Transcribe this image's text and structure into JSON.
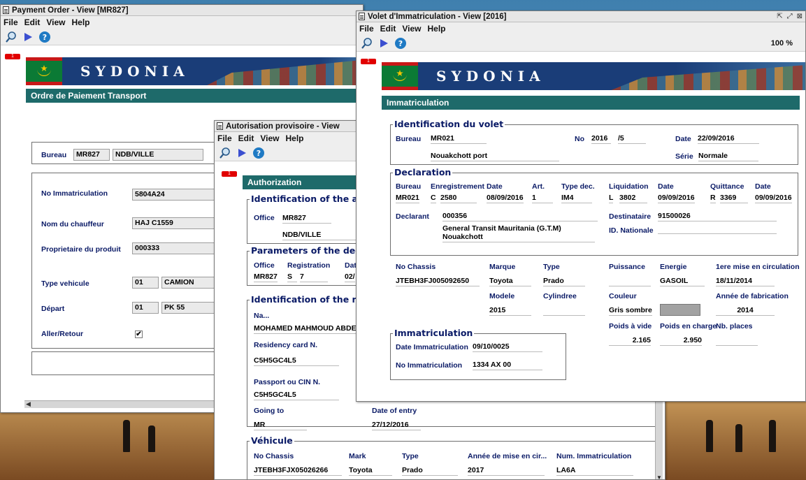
{
  "payment_window": {
    "title": "Payment Order - View [MR827]",
    "menu": [
      "File",
      "Edit",
      "View",
      "Help"
    ],
    "page_tag": "1",
    "banner_brand": "SYDONIA",
    "section_title": "Ordre de Paiement Transport",
    "bureau_label": "Bureau",
    "bureau_code": "MR827",
    "bureau_name": "NDB/VILLE",
    "fields": {
      "immatriculation_label": "No Immatriculation",
      "immatriculation_value": "5804A24",
      "chauffeur_label": "Nom du chauffeur",
      "chauffeur_value": "HAJ  C1559",
      "proprietaire_label": "Proprietaire du produit",
      "proprietaire_value": "000333",
      "type_vehicule_label": "Type vehicule",
      "type_vehicule_code": "01",
      "type_vehicule_value": "CAMION",
      "depart_label": "Départ",
      "depart_code": "01",
      "depart_value": "PK 55",
      "aller_retour_label": "Aller/Retour",
      "aller_retour_check": "✔"
    },
    "scroll_left": "◀"
  },
  "auth_window": {
    "title": "Autorisation provisoire - View",
    "menu": [
      "File",
      "Edit",
      "View",
      "Help"
    ],
    "page_tag": "1",
    "section_title": "Authorization",
    "identification_title": "Identification of the aut",
    "office_label": "Office",
    "office_code": "MR827",
    "office_name": "NDB/VILLE",
    "parameters_title": "Parameters of the decl",
    "param_office_label": "Office",
    "param_registration_label": "Registration",
    "param_date_label": "Dat",
    "param_office_value": "MR827",
    "param_registration_series": "S",
    "param_registration_number": "7",
    "param_date_value": "02/",
    "recipient_title": "Identification of the rec",
    "name_label": "Na...",
    "name_value": "MOHAMED MAHMOUD ABDELL",
    "residency_label": "Residency card N.",
    "residency_value": "C5H5GC4L5",
    "passport_label": "Passport ou CIN N.",
    "passport_value": "C5H5GC4L5",
    "going_to_label": "Going to",
    "going_to_value": "MR",
    "date_entry_label": "Date of entry",
    "date_entry_value": "27/12/2016",
    "vehicule_title": "Véhicule",
    "vehicule_headers": [
      "No Chassis",
      "Mark",
      "Type",
      "Année de mise en cir...",
      "Num. Immatriculation"
    ],
    "vehicule_values": [
      "JTEBH3FJX05026266",
      "Toyota",
      "Prado",
      "2017",
      "LA6A"
    ],
    "scroll_down": "▼"
  },
  "volet_window": {
    "title": "Volet d'Immatriculation - View [2016]",
    "title_controls": [
      "⇱",
      "⤢",
      "⊠"
    ],
    "menu": [
      "File",
      "Edit",
      "View",
      "Help"
    ],
    "zoom": "100 %",
    "page_tag": "1",
    "banner_brand": "SYDONIA",
    "section_title": "Immatriculation",
    "identification": {
      "title": "Identification du volet",
      "bureau_label": "Bureau",
      "bureau_value": "MR021",
      "no_label": "No",
      "no_year": "2016",
      "no_number": "/5",
      "date_label": "Date",
      "date_value": "22/09/2016",
      "bureau_name": "Nouakchott port",
      "serie_label": "Série",
      "serie_value": "Normale"
    },
    "declaration": {
      "title": "Declaration",
      "headers": [
        "Bureau",
        "Enregistrement",
        "Date",
        "Art.",
        "Type dec.",
        "Liquidation",
        "Date",
        "Quittance",
        "Date"
      ],
      "bureau": "MR021",
      "enr_series": "C",
      "enr_number": "2580",
      "enr_date": "08/09/2016",
      "article": "1",
      "type_dec": "IM4",
      "liq_series": "L",
      "liq_number": "3802",
      "liq_date": "09/09/2016",
      "quit_series": "R",
      "quit_number": "3369",
      "quit_date": "09/09/2016",
      "declarant_label": "Declarant",
      "declarant_code": "000356",
      "declarant_name": "General Transit Mauritania (G.T.M)",
      "declarant_city": "Nouakchott",
      "destinataire_label": "Destinataire",
      "destinataire_value": "91500026",
      "id_nationale_label": "ID. Nationale"
    },
    "vehicle": {
      "chassis_label": "No Chassis",
      "chassis_value": "JTEBH3FJ005092650",
      "marque_label": "Marque",
      "marque_value": "Toyota",
      "type_label": "Type",
      "type_value": "Prado",
      "puissance_label": "Puissance",
      "energie_label": "Energie",
      "energie_value": "GASOIL",
      "premiere_label": "1ere mise en circulation",
      "premiere_value": "18/11/2014",
      "modele_label": "Modele",
      "modele_value": "2015",
      "cylindree_label": "Cylindree",
      "couleur_label": "Couleur",
      "couleur_value": "Gris sombre",
      "annee_label": "Année de fabrication",
      "annee_value": "2014",
      "poids_vide_label": "Poids à vide",
      "poids_vide_value": "2.165",
      "poids_charge_label": "Poids en charge",
      "poids_charge_value": "2.950",
      "places_label": "Nb. places"
    },
    "immatriculation": {
      "title": "Immatriculation",
      "date_label": "Date Immatriculation",
      "date_value": "09/10/0025",
      "no_label": "No Immatriculation",
      "no_value": "1334 AX 00"
    }
  },
  "colors": {
    "section_bar": "#1e6a6a",
    "label_blue": "#0a1a66",
    "page_tag_red": "#e10000"
  }
}
